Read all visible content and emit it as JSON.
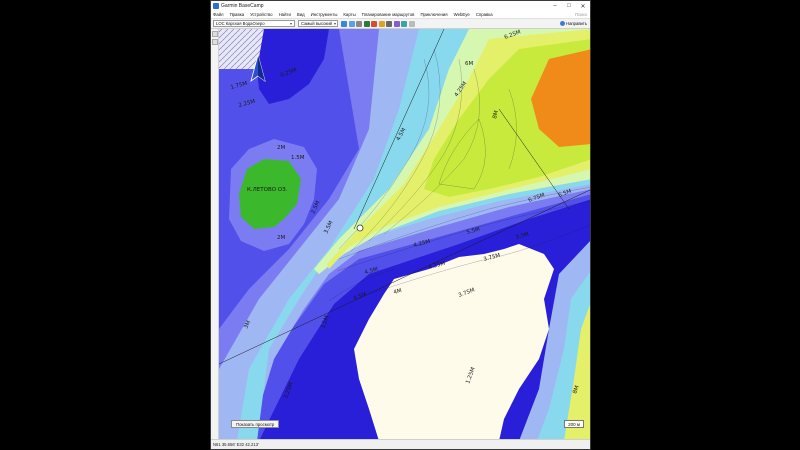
{
  "window": {
    "title": "Garmin BaseCamp",
    "search_placeholder": "Поиск"
  },
  "menu": [
    "Файл",
    "Правка",
    "Устройство",
    "Найти",
    "Вид",
    "Инструменты",
    "Карты",
    "Планирование маршрутов",
    "Приключения",
    "WebEye",
    "Справка"
  ],
  "toolbar": {
    "map_select": "LOC Карская ВодаОзеро",
    "detail_select": "Самый высокий",
    "route_button": "Направить"
  },
  "map": {
    "depth_labels": [
      "6.25M",
      "6M",
      "4.25M",
      "4.5M",
      "8M",
      "6.75M",
      "6.5M",
      "5.5M",
      "4.25M",
      "4.5M",
      "4.25M",
      "3.75M",
      "4.5M",
      "4M",
      "3.75M",
      "3.5M",
      "2.25M",
      "1.75M",
      "2M",
      "1.5M",
      "2.5M",
      "3.5M",
      "2M",
      "3M",
      "3.5M",
      "8M",
      "3.25M",
      "1.25M",
      "0.25M"
    ],
    "island_label": "К.ЛЕТОВО ОЗ.",
    "colors": {
      "deep": "#2a1fd8",
      "mid_deep": "#5250ea",
      "mid": "#7c7cf2",
      "light_blue": "#9fb8f4",
      "cyan": "#89d9ee",
      "pale_green": "#d6f7b0",
      "yellow_green": "#e4f06a",
      "lime": "#c8ea3c",
      "orange": "#f08a18",
      "land": "#fffbea",
      "island": "#3bb82c"
    }
  },
  "overlay": {
    "show_overview": "Показать просмотр",
    "scale": "200 м"
  },
  "status": {
    "coordinates": "N61 35.656' E32 42.213'"
  }
}
